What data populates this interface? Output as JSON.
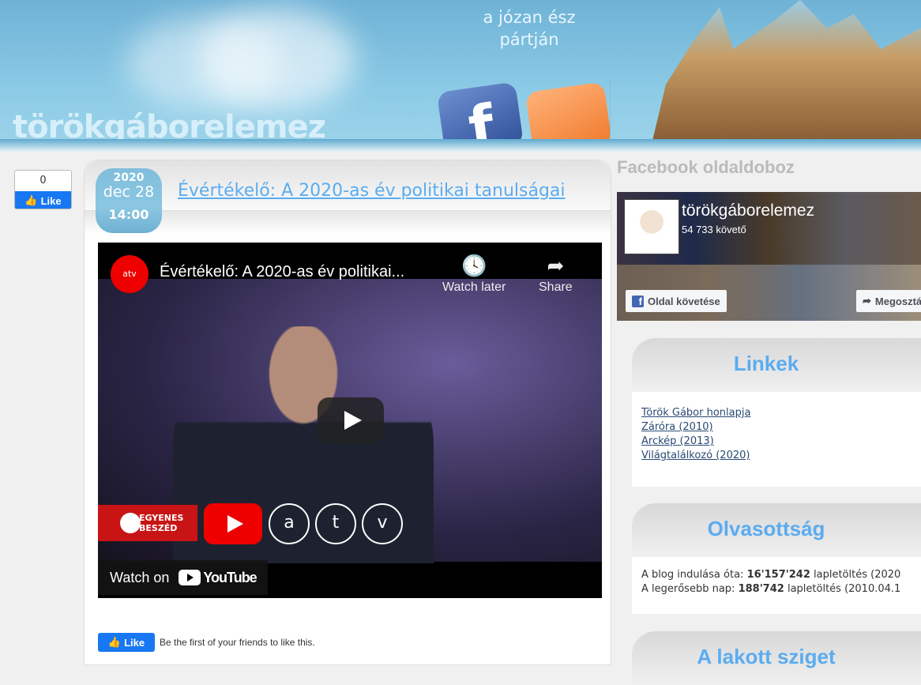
{
  "header": {
    "logo": "törökgáborelemez",
    "slogan_line1": "a józan ész",
    "slogan_line2": "pártján",
    "icons": [
      "facebook-icon",
      "rss-icon"
    ]
  },
  "side_like": {
    "count": "0",
    "label": "Like"
  },
  "post": {
    "date": {
      "year": "2020",
      "day": "dec 28",
      "time": "14:00"
    },
    "title": "Évértékelő: A 2020-as év politikai tanulságai",
    "video": {
      "channel": "atv",
      "title": "Évértékelő: A 2020-as év politikai...",
      "watch_later": "Watch later",
      "share": "Share",
      "badge_line1": "EGYENES",
      "badge_line2": "BESZÉD",
      "atv_letters": [
        "a",
        "t",
        "v"
      ],
      "watch_on": "Watch on",
      "youtube": "YouTube"
    },
    "like": {
      "label": "Like",
      "text": "Be the first of your friends to like this."
    }
  },
  "sidebar": {
    "fb_box_title": "Facebook oldaldoboz",
    "fb_page": {
      "name": "törökgáborelemez",
      "followers": "54 733 követő",
      "follow": "Oldal követése",
      "share": "Megosztás"
    },
    "links": {
      "title": "Linkek",
      "items": [
        "Török Gábor honlapja",
        "Záróra (2010)",
        "Arckép (2013)",
        "Világtalálkozó (2020)"
      ]
    },
    "stats": {
      "title": "Olvasottság",
      "line1_pre": "A blog indulása óta: ",
      "line1_num": "16'157'242",
      "line1_post": " lapletöltés (2020",
      "line2_pre": "A legerősebb nap: ",
      "line2_num": "188'742",
      "line2_post": " lapletöltés (2010.04.1"
    },
    "next_widget_title": "A lakott sziget"
  },
  "colors": {
    "accent": "#5aacf0",
    "facebook": "#1877f2"
  }
}
